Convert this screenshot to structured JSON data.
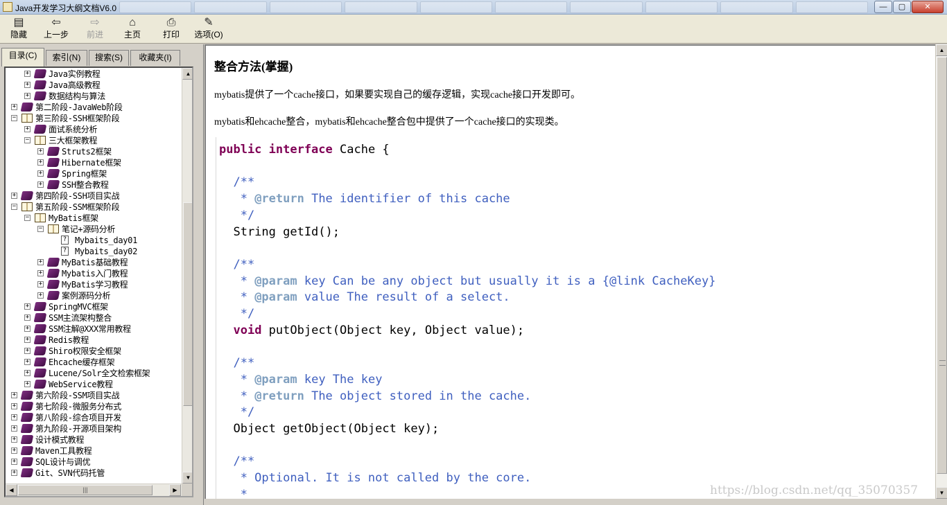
{
  "window": {
    "title": "Java开发学习大纲文档V6.0",
    "minimize": "0",
    "maximize": "1",
    "close": "r"
  },
  "toolbar": {
    "hide": "隐藏",
    "back": "上一步",
    "forward": "前进",
    "home": "主页",
    "print": "打印",
    "options": "选项(O)"
  },
  "tabs": [
    {
      "label": "目录(C)"
    },
    {
      "label": "索引(N)"
    },
    {
      "label": "搜索(S)"
    },
    {
      "label": "收藏夹(I)"
    }
  ],
  "tree": [
    {
      "label": "Java实例教程",
      "level": 1,
      "type": "book",
      "expanded": false
    },
    {
      "label": "Java高级教程",
      "level": 1,
      "type": "book",
      "expanded": false
    },
    {
      "label": "数据结构与算法",
      "level": 1,
      "type": "book",
      "expanded": false
    },
    {
      "label": "第二阶段-JavaWeb阶段",
      "level": 0,
      "type": "book",
      "expanded": false
    },
    {
      "label": "第三阶段-SSH框架阶段",
      "level": 0,
      "type": "book",
      "expanded": true
    },
    {
      "label": "面试系统分析",
      "level": 1,
      "type": "book",
      "expanded": false
    },
    {
      "label": "三大框架教程",
      "level": 1,
      "type": "book",
      "expanded": true
    },
    {
      "label": "Struts2框架",
      "level": 2,
      "type": "book",
      "expanded": false
    },
    {
      "label": "Hibernate框架",
      "level": 2,
      "type": "book",
      "expanded": false
    },
    {
      "label": "Spring框架",
      "level": 2,
      "type": "book",
      "expanded": false
    },
    {
      "label": "SSH整合教程",
      "level": 2,
      "type": "book",
      "expanded": false
    },
    {
      "label": "第四阶段-SSH项目实战",
      "level": 0,
      "type": "book",
      "expanded": false
    },
    {
      "label": "第五阶段-SSM框架阶段",
      "level": 0,
      "type": "book",
      "expanded": true
    },
    {
      "label": "MyBatis框架",
      "level": 1,
      "type": "book",
      "expanded": true
    },
    {
      "label": "笔记+源码分析",
      "level": 2,
      "type": "book",
      "expanded": true
    },
    {
      "label": "Mybaits_day01",
      "level": 3,
      "type": "page"
    },
    {
      "label": "Mybaits_day02",
      "level": 3,
      "type": "page"
    },
    {
      "label": "MyBatis基础教程",
      "level": 2,
      "type": "book",
      "expanded": false
    },
    {
      "label": "Mybatis入门教程",
      "level": 2,
      "type": "book",
      "expanded": false
    },
    {
      "label": "MyBatis学习教程",
      "level": 2,
      "type": "book",
      "expanded": false
    },
    {
      "label": "案例源码分析",
      "level": 2,
      "type": "book",
      "expanded": false
    },
    {
      "label": "SpringMVC框架",
      "level": 1,
      "type": "book",
      "expanded": false
    },
    {
      "label": "SSM主流架构整合",
      "level": 1,
      "type": "book",
      "expanded": false
    },
    {
      "label": "SSM注解@XXX常用教程",
      "level": 1,
      "type": "book",
      "expanded": false
    },
    {
      "label": "Redis教程",
      "level": 1,
      "type": "book",
      "expanded": false
    },
    {
      "label": "Shiro权限安全框架",
      "level": 1,
      "type": "book",
      "expanded": false
    },
    {
      "label": "Ehcache缓存框架",
      "level": 1,
      "type": "book",
      "expanded": false
    },
    {
      "label": "Lucene/Solr全文检索框架",
      "level": 1,
      "type": "book",
      "expanded": false
    },
    {
      "label": "WebService教程",
      "level": 1,
      "type": "book",
      "expanded": false
    },
    {
      "label": "第六阶段-SSM项目实战",
      "level": 0,
      "type": "book",
      "expanded": false
    },
    {
      "label": "第七阶段-微服务分布式",
      "level": 0,
      "type": "book",
      "expanded": false
    },
    {
      "label": "第八阶段-综合项目开发",
      "level": 0,
      "type": "book",
      "expanded": false
    },
    {
      "label": "第九阶段-开源项目架构",
      "level": 0,
      "type": "book",
      "expanded": false
    },
    {
      "label": "设计模式教程",
      "level": 0,
      "type": "book",
      "expanded": false
    },
    {
      "label": "Maven工具教程",
      "level": 0,
      "type": "book",
      "expanded": false
    },
    {
      "label": "SQL设计与调优",
      "level": 0,
      "type": "book",
      "expanded": false
    },
    {
      "label": "Git、SVN代码托管",
      "level": 0,
      "type": "book",
      "expanded": false
    }
  ],
  "content": {
    "title": "整合方法(掌握)",
    "para1": "mybatis提供了一个cache接口，如果要实现自己的缓存逻辑，实现cache接口开发即可。",
    "para2": "mybatis和ehcache整合，mybatis和ehcache整合包中提供了一个cache接口的实现类。",
    "code": [
      {
        "segments": [
          {
            "t": "public interface",
            "c": "kw"
          },
          {
            "t": " Cache {",
            "c": ""
          }
        ]
      },
      {
        "segments": []
      },
      {
        "segments": [
          {
            "t": "  /**",
            "c": "cm"
          }
        ]
      },
      {
        "segments": [
          {
            "t": "   * ",
            "c": "cm"
          },
          {
            "t": "@return",
            "c": "ann"
          },
          {
            "t": " The identifier of this cache",
            "c": "cm"
          }
        ]
      },
      {
        "segments": [
          {
            "t": "   */",
            "c": "cm"
          }
        ]
      },
      {
        "segments": [
          {
            "t": "  String getId();",
            "c": ""
          }
        ]
      },
      {
        "segments": []
      },
      {
        "segments": [
          {
            "t": "  /**",
            "c": "cm"
          }
        ]
      },
      {
        "segments": [
          {
            "t": "   * ",
            "c": "cm"
          },
          {
            "t": "@param",
            "c": "ann"
          },
          {
            "t": " key Can be any object but usually it is a {@link CacheKey}",
            "c": "cm"
          }
        ]
      },
      {
        "segments": [
          {
            "t": "   * ",
            "c": "cm"
          },
          {
            "t": "@param",
            "c": "ann"
          },
          {
            "t": " value The result of a select.",
            "c": "cm"
          }
        ]
      },
      {
        "segments": [
          {
            "t": "   */",
            "c": "cm"
          }
        ]
      },
      {
        "segments": [
          {
            "t": "  ",
            "c": ""
          },
          {
            "t": "void",
            "c": "kw"
          },
          {
            "t": " putObject(Object key, Object value);",
            "c": ""
          }
        ]
      },
      {
        "segments": []
      },
      {
        "segments": [
          {
            "t": "  /**",
            "c": "cm"
          }
        ]
      },
      {
        "segments": [
          {
            "t": "   * ",
            "c": "cm"
          },
          {
            "t": "@param",
            "c": "ann"
          },
          {
            "t": " key The key",
            "c": "cm"
          }
        ]
      },
      {
        "segments": [
          {
            "t": "   * ",
            "c": "cm"
          },
          {
            "t": "@return",
            "c": "ann"
          },
          {
            "t": " The object stored in the cache.",
            "c": "cm"
          }
        ]
      },
      {
        "segments": [
          {
            "t": "   */",
            "c": "cm"
          }
        ]
      },
      {
        "segments": [
          {
            "t": "  Object getObject(Object key);",
            "c": ""
          }
        ]
      },
      {
        "segments": []
      },
      {
        "segments": [
          {
            "t": "  /**",
            "c": "cm"
          }
        ]
      },
      {
        "segments": [
          {
            "t": "   * Optional. It is not called by the core.",
            "c": "cm"
          }
        ]
      },
      {
        "segments": [
          {
            "t": "   *",
            "c": "cm"
          }
        ]
      }
    ]
  },
  "watermark": "https://blog.csdn.net/qq_35070357",
  "colors": {
    "keyword": "#7f0055",
    "comment": "#3f5fbf",
    "annotation": "#7f9fbf",
    "book": "#6b2070"
  },
  "icons": {
    "hide": "hide-pane-icon",
    "back": "arrow-left-icon",
    "forward": "arrow-right-icon",
    "home": "home-icon",
    "print": "printer-icon",
    "options": "options-icon"
  }
}
